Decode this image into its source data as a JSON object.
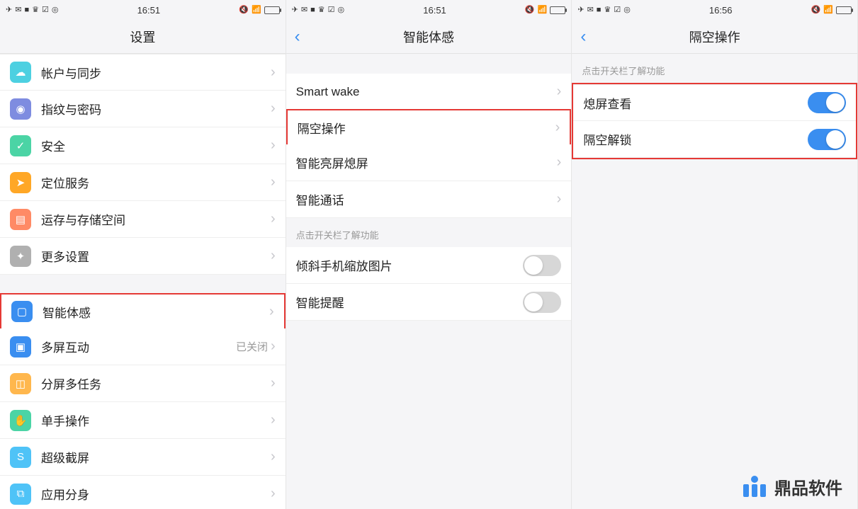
{
  "screen1": {
    "time": "16:51",
    "title": "设置",
    "items": [
      {
        "label": "帐户与同步",
        "icon": "ic-cloud",
        "glyph": "☁"
      },
      {
        "label": "指纹与密码",
        "icon": "ic-finger",
        "glyph": "◉"
      },
      {
        "label": "安全",
        "icon": "ic-security",
        "glyph": "✓"
      },
      {
        "label": "定位服务",
        "icon": "ic-location",
        "glyph": "➤"
      },
      {
        "label": "运存与存储空间",
        "icon": "ic-storage",
        "glyph": "▤"
      },
      {
        "label": "更多设置",
        "icon": "ic-more",
        "glyph": "✦"
      }
    ],
    "items2": [
      {
        "label": "智能体感",
        "icon": "ic-motion",
        "glyph": "▢",
        "highlight": true
      },
      {
        "label": "多屏互动",
        "icon": "ic-multiscreen",
        "glyph": "▣",
        "value": "已关闭"
      },
      {
        "label": "分屏多任务",
        "icon": "ic-split",
        "glyph": "◫"
      },
      {
        "label": "单手操作",
        "icon": "ic-onehand",
        "glyph": "✋"
      },
      {
        "label": "超级截屏",
        "icon": "ic-sshot",
        "glyph": "S"
      },
      {
        "label": "应用分身",
        "icon": "ic-clone",
        "glyph": "⧉"
      }
    ]
  },
  "screen2": {
    "time": "16:51",
    "title": "智能体感",
    "items": [
      {
        "label": "Smart wake"
      },
      {
        "label": "隔空操作",
        "highlight": true
      },
      {
        "label": "智能亮屏熄屏"
      },
      {
        "label": "智能通话"
      }
    ],
    "caption": "点击开关栏了解功能",
    "toggles": [
      {
        "label": "倾斜手机缩放图片",
        "on": false
      },
      {
        "label": "智能提醒",
        "on": false
      }
    ]
  },
  "screen3": {
    "time": "16:56",
    "title": "隔空操作",
    "caption": "点击开关栏了解功能",
    "toggles": [
      {
        "label": "熄屏查看",
        "on": true
      },
      {
        "label": "隔空解锁",
        "on": true
      }
    ]
  },
  "watermark": "鼎品软件"
}
